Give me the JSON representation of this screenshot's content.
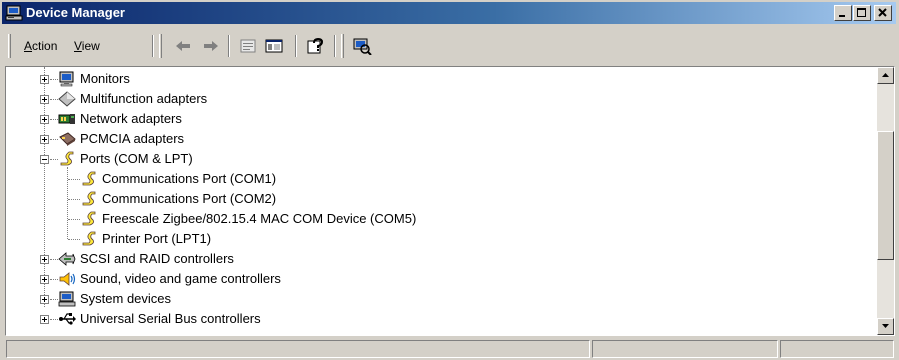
{
  "window": {
    "title": "Device Manager",
    "title_icon": "computer-manage-icon",
    "buttons": [
      "minimize",
      "maximize",
      "close"
    ]
  },
  "menu": {
    "action": {
      "mnemonic": "A",
      "rest": "ction"
    },
    "view": {
      "mnemonic": "V",
      "rest": "iew"
    }
  },
  "toolbar": {
    "tools": [
      "back-arrow-icon",
      "forward-arrow-icon",
      "properties-icon",
      "show-hide-console-tree-icon",
      "help-icon",
      "scan-hardware-icon"
    ]
  },
  "tree": {
    "nodes": [
      {
        "label": "Monitors",
        "icon": "monitor-icon",
        "expanded": false
      },
      {
        "label": "Multifunction adapters",
        "icon": "multifunction-icon",
        "expanded": false
      },
      {
        "label": "Network adapters",
        "icon": "network-card-icon",
        "expanded": false
      },
      {
        "label": "PCMCIA adapters",
        "icon": "pcmcia-icon",
        "expanded": false
      },
      {
        "label": "Ports (COM & LPT)",
        "icon": "port-icon",
        "expanded": true,
        "children": [
          {
            "label": "Communications Port (COM1)",
            "icon": "port-icon"
          },
          {
            "label": "Communications Port (COM2)",
            "icon": "port-icon"
          },
          {
            "label": "Freescale Zigbee/802.15.4 MAC COM Device (COM5)",
            "icon": "port-icon"
          },
          {
            "label": "Printer Port (LPT1)",
            "icon": "port-icon"
          }
        ]
      },
      {
        "label": "SCSI and RAID controllers",
        "icon": "scsi-icon",
        "expanded": false
      },
      {
        "label": "Sound, video and game controllers",
        "icon": "sound-icon",
        "expanded": false
      },
      {
        "label": "System devices",
        "icon": "system-device-icon",
        "expanded": false
      },
      {
        "label": "Universal Serial Bus controllers",
        "icon": "usb-icon",
        "expanded": false
      }
    ]
  },
  "scrollbar": {
    "thumb_position_fraction": 0.45,
    "thumb_size_fraction": 0.55
  },
  "colors": {
    "titlebar_start": "#0a246a",
    "titlebar_end": "#a6caf0",
    "chrome": "#d4d0c8",
    "tree_background": "#ffffff"
  }
}
